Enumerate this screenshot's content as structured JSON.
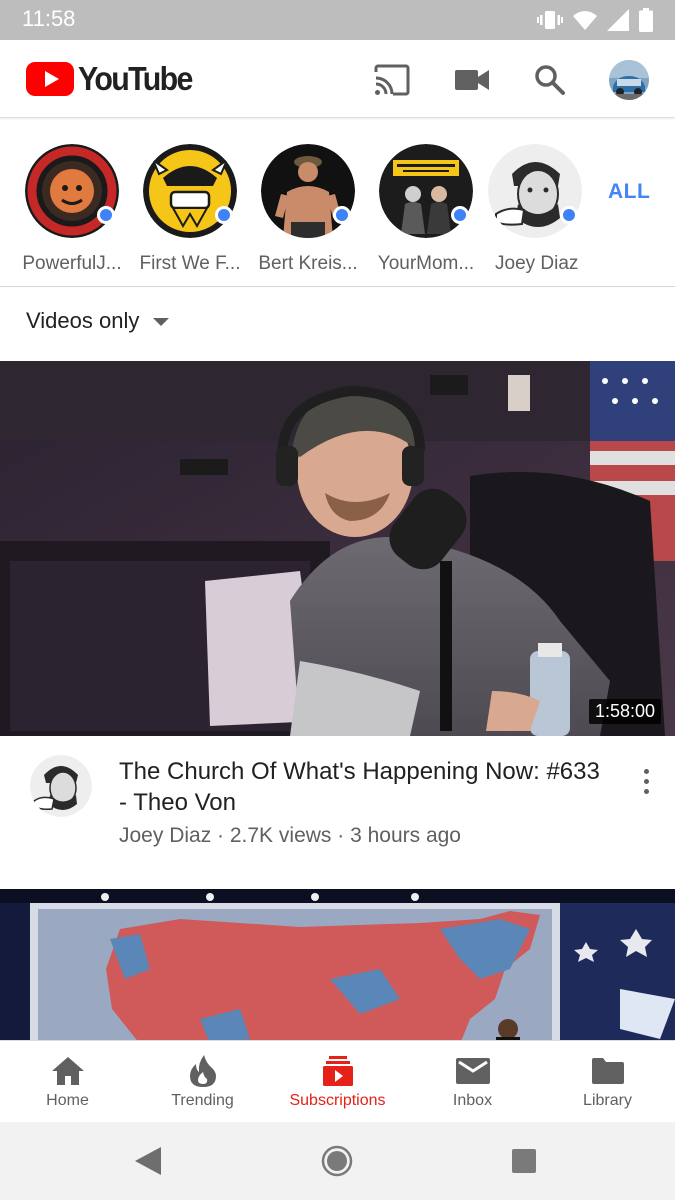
{
  "status_bar": {
    "time": "11:58"
  },
  "app": {
    "title": "YouTube"
  },
  "channels": {
    "items": [
      {
        "name": "PowerfulJ...",
        "avatar": "joe-rogan-experience-logo",
        "has_new": true
      },
      {
        "name": "First We F...",
        "avatar": "first-we-feast-viking-logo",
        "has_new": true
      },
      {
        "name": "Bert Kreis...",
        "avatar": "bert-kreischer-photo",
        "has_new": true
      },
      {
        "name": "YourMom...",
        "avatar": "your-moms-house-logo",
        "has_new": true
      },
      {
        "name": "Joey Diaz",
        "avatar": "joey-diaz-illustration",
        "has_new": true
      }
    ],
    "all_label": "ALL"
  },
  "filter": {
    "label": "Videos only"
  },
  "video": {
    "duration": "1:58:00",
    "title": "The Church Of What's Happening Now: #633 - Theo Von",
    "channel": "Joey Diaz",
    "views": "2.7K views",
    "age": "3 hours ago",
    "meta": "Joey Diaz · 2.7K views · 3 hours ago"
  },
  "bottom_nav": {
    "items": [
      {
        "label": "Home",
        "icon": "home-icon"
      },
      {
        "label": "Trending",
        "icon": "flame-icon"
      },
      {
        "label": "Subscriptions",
        "icon": "subscriptions-icon",
        "active": true
      },
      {
        "label": "Inbox",
        "icon": "mail-icon"
      },
      {
        "label": "Library",
        "icon": "folder-icon"
      }
    ]
  },
  "colors": {
    "accent_red": "#e62117",
    "link_blue": "#4285f4",
    "text_primary": "#212121",
    "text_secondary": "#606060",
    "status_bar": "#bdbdbd"
  }
}
